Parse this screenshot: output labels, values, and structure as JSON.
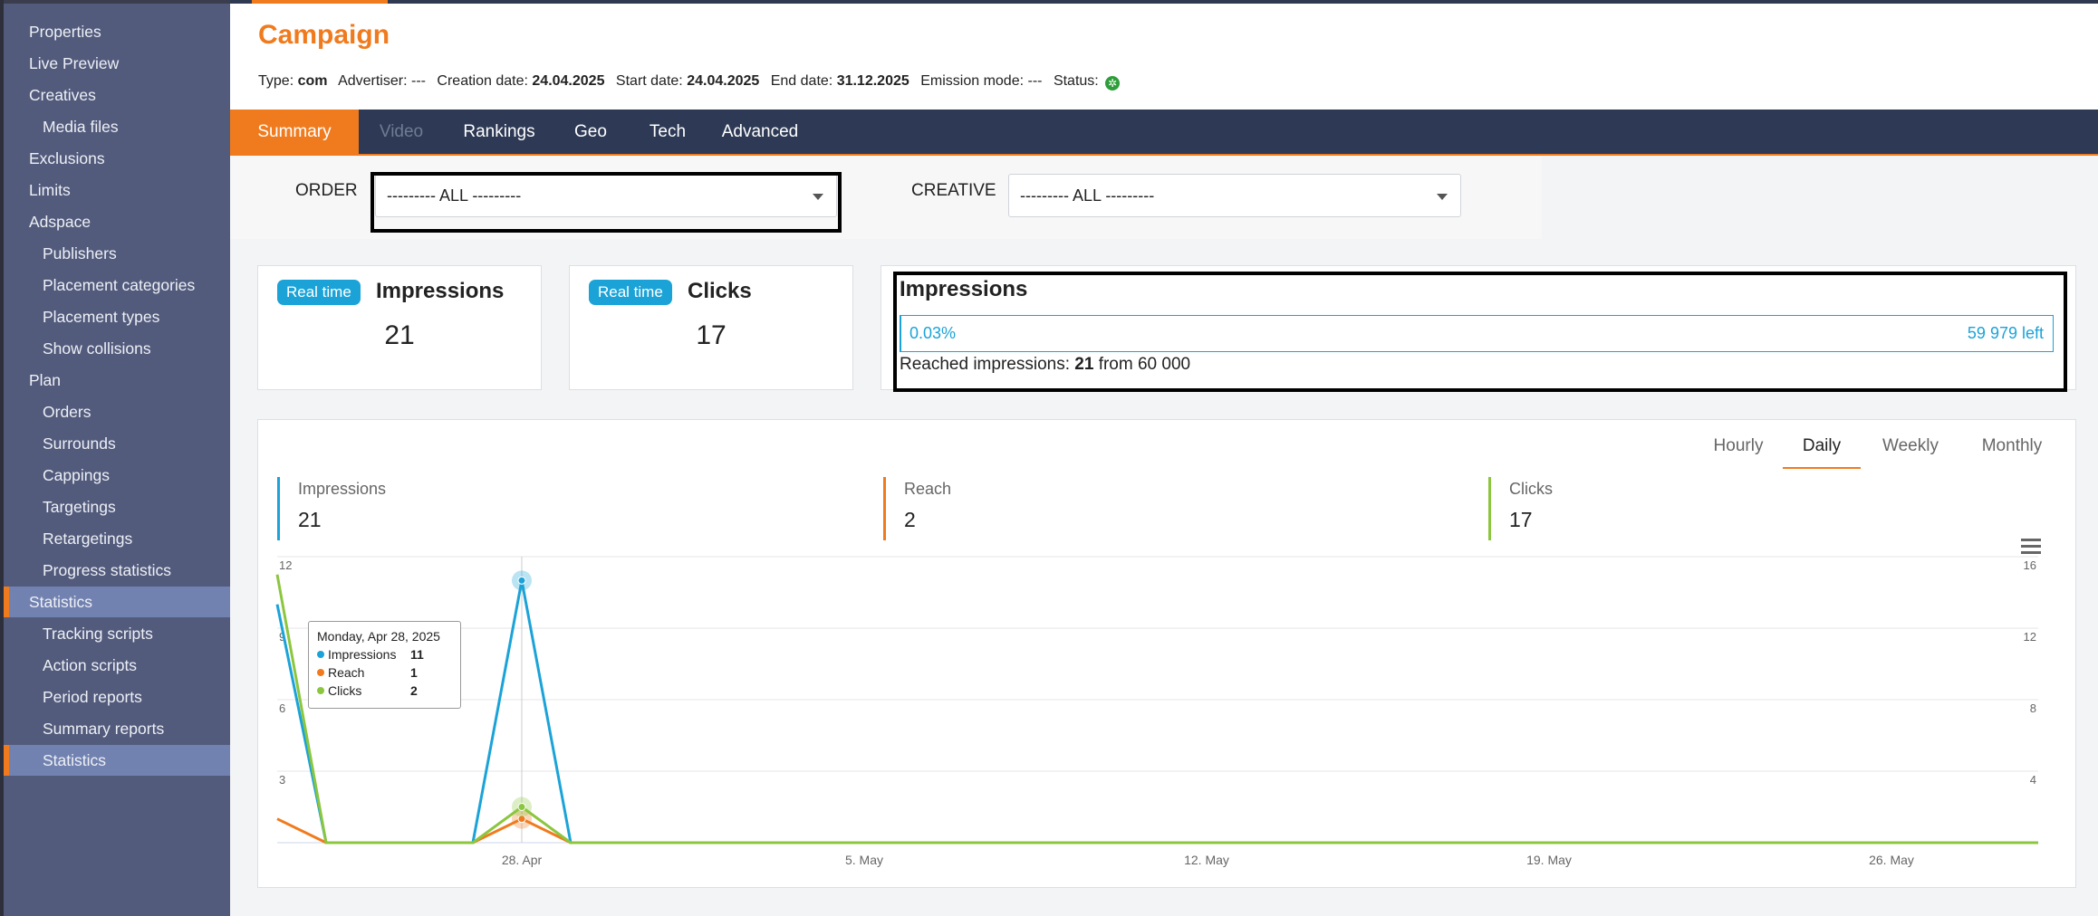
{
  "sidebar": {
    "items": [
      {
        "label": "Properties",
        "level": 0,
        "active": false
      },
      {
        "label": "Live Preview",
        "level": 0,
        "active": false
      },
      {
        "label": "Creatives",
        "level": 0,
        "active": false
      },
      {
        "label": "Media files",
        "level": 1,
        "active": false
      },
      {
        "label": "Exclusions",
        "level": 0,
        "active": false
      },
      {
        "label": "Limits",
        "level": 0,
        "active": false
      },
      {
        "label": "Adspace",
        "level": 0,
        "active": false
      },
      {
        "label": "Publishers",
        "level": 1,
        "active": false
      },
      {
        "label": "Placement categories",
        "level": 1,
        "active": false
      },
      {
        "label": "Placement types",
        "level": 1,
        "active": false
      },
      {
        "label": "Show collisions",
        "level": 1,
        "active": false
      },
      {
        "label": "Plan",
        "level": 0,
        "active": false
      },
      {
        "label": "Orders",
        "level": 1,
        "active": false
      },
      {
        "label": "Surrounds",
        "level": 1,
        "active": false
      },
      {
        "label": "Cappings",
        "level": 1,
        "active": false
      },
      {
        "label": "Targetings",
        "level": 1,
        "active": false
      },
      {
        "label": "Retargetings",
        "level": 1,
        "active": false
      },
      {
        "label": "Progress statistics",
        "level": 1,
        "active": false
      },
      {
        "label": "Statistics",
        "level": 0,
        "active": true
      },
      {
        "label": "Tracking scripts",
        "level": 1,
        "active": false
      },
      {
        "label": "Action scripts",
        "level": 1,
        "active": false
      },
      {
        "label": "Period reports",
        "level": 1,
        "active": false
      },
      {
        "label": "Summary reports",
        "level": 1,
        "active": false
      },
      {
        "label": "Statistics",
        "level": 1,
        "active": true
      }
    ]
  },
  "header": {
    "title": "Campaign",
    "type_label": "Type:",
    "type_value": "com",
    "advertiser_label": "Advertiser:",
    "advertiser_value": "---",
    "creation_label": "Creation date:",
    "creation_value": "24.04.2025",
    "start_label": "Start date:",
    "start_value": "24.04.2025",
    "end_label": "End date:",
    "end_value": "31.12.2025",
    "emission_label": "Emission mode:",
    "emission_value": "---",
    "status_label": "Status:",
    "status_icon": "active-status-icon",
    "status_color": "#2e9e3a"
  },
  "tabs": [
    {
      "label": "Summary",
      "active": true,
      "disabled": false
    },
    {
      "label": "Video",
      "active": false,
      "disabled": true
    },
    {
      "label": "Rankings",
      "active": false,
      "disabled": false
    },
    {
      "label": "Geo",
      "active": false,
      "disabled": false
    },
    {
      "label": "Tech",
      "active": false,
      "disabled": false
    },
    {
      "label": "Advanced",
      "active": false,
      "disabled": false
    }
  ],
  "filters": {
    "order_label": "ORDER",
    "order_value": "--------- ALL ---------",
    "creative_label": "CREATIVE",
    "creative_value": "--------- ALL ---------"
  },
  "cards": {
    "impressions": {
      "badge": "Real time",
      "title": "Impressions",
      "value": "21"
    },
    "clicks": {
      "badge": "Real time",
      "title": "Clicks",
      "value": "17"
    },
    "progress": {
      "title": "Impressions",
      "percent_text": "0.03%",
      "percent_value": 0.035,
      "left_text": "59 979 left",
      "reached_prefix": "Reached impressions:",
      "reached_value": "21",
      "reached_from": "from 60 000"
    }
  },
  "chart_panel": {
    "periods": [
      {
        "label": "Hourly",
        "active": false
      },
      {
        "label": "Daily",
        "active": true
      },
      {
        "label": "Weekly",
        "active": false
      },
      {
        "label": "Monthly",
        "active": false
      }
    ],
    "kpis": [
      {
        "label": "Impressions",
        "value": "21",
        "color": "#1ba3d8"
      },
      {
        "label": "Reach",
        "value": "2",
        "color": "#f07b1e"
      },
      {
        "label": "Clicks",
        "value": "17",
        "color": "#8cc63f"
      }
    ],
    "tooltip": {
      "date": "Monday, Apr 28, 2025",
      "rows": [
        {
          "label": "Impressions",
          "value": "11",
          "color": "#1ba3d8"
        },
        {
          "label": "Reach",
          "value": "1",
          "color": "#f07b1e"
        },
        {
          "label": "Clicks",
          "value": "2",
          "color": "#8cc63f"
        }
      ]
    }
  },
  "chart_data": {
    "type": "line",
    "x": [
      "2025-04-23",
      "2025-04-24",
      "2025-04-25",
      "2025-04-26",
      "2025-04-27",
      "2025-04-28",
      "2025-04-29",
      "2025-04-30",
      "2025-05-01",
      "2025-05-02",
      "2025-05-03",
      "2025-05-04",
      "2025-05-05",
      "2025-05-06",
      "2025-05-07",
      "2025-05-08",
      "2025-05-09",
      "2025-05-10",
      "2025-05-11",
      "2025-05-12",
      "2025-05-13",
      "2025-05-14",
      "2025-05-15",
      "2025-05-16",
      "2025-05-17",
      "2025-05-18",
      "2025-05-19",
      "2025-05-20",
      "2025-05-21",
      "2025-05-22",
      "2025-05-23",
      "2025-05-24",
      "2025-05-25",
      "2025-05-26",
      "2025-05-27",
      "2025-05-28",
      "2025-05-29"
    ],
    "x_tick_labels": [
      "28. Apr",
      "5. May",
      "12. May",
      "19. May",
      "26. May"
    ],
    "x_tick_dates": [
      "2025-04-28",
      "2025-05-05",
      "2025-05-12",
      "2025-05-19",
      "2025-05-26"
    ],
    "y_left_ticks": [
      "3",
      "6",
      "9",
      "12"
    ],
    "y_right_ticks": [
      "4",
      "8",
      "12",
      "16"
    ],
    "y_left_range": [
      0,
      12
    ],
    "y_right_range": [
      0,
      16
    ],
    "grid": true,
    "series": [
      {
        "name": "Impressions",
        "color": "#1ba3d8",
        "axis": "left",
        "values": [
          10,
          0,
          0,
          0,
          0,
          11,
          0,
          0,
          0,
          0,
          0,
          0,
          0,
          0,
          0,
          0,
          0,
          0,
          0,
          0,
          0,
          0,
          0,
          0,
          0,
          0,
          0,
          0,
          0,
          0,
          0,
          0,
          0,
          0,
          0,
          0,
          0
        ]
      },
      {
        "name": "Reach",
        "color": "#f07b1e",
        "axis": "left",
        "values": [
          1,
          0,
          0,
          0,
          0,
          1,
          0,
          0,
          0,
          0,
          0,
          0,
          0,
          0,
          0,
          0,
          0,
          0,
          0,
          0,
          0,
          0,
          0,
          0,
          0,
          0,
          0,
          0,
          0,
          0,
          0,
          0,
          0,
          0,
          0,
          0,
          0
        ]
      },
      {
        "name": "Clicks",
        "color": "#8cc63f",
        "axis": "right",
        "values": [
          15,
          0,
          0,
          0,
          0,
          2,
          0,
          0,
          0,
          0,
          0,
          0,
          0,
          0,
          0,
          0,
          0,
          0,
          0,
          0,
          0,
          0,
          0,
          0,
          0,
          0,
          0,
          0,
          0,
          0,
          0,
          0,
          0,
          0,
          0,
          0,
          0
        ]
      }
    ],
    "highlighted_index": 5
  }
}
